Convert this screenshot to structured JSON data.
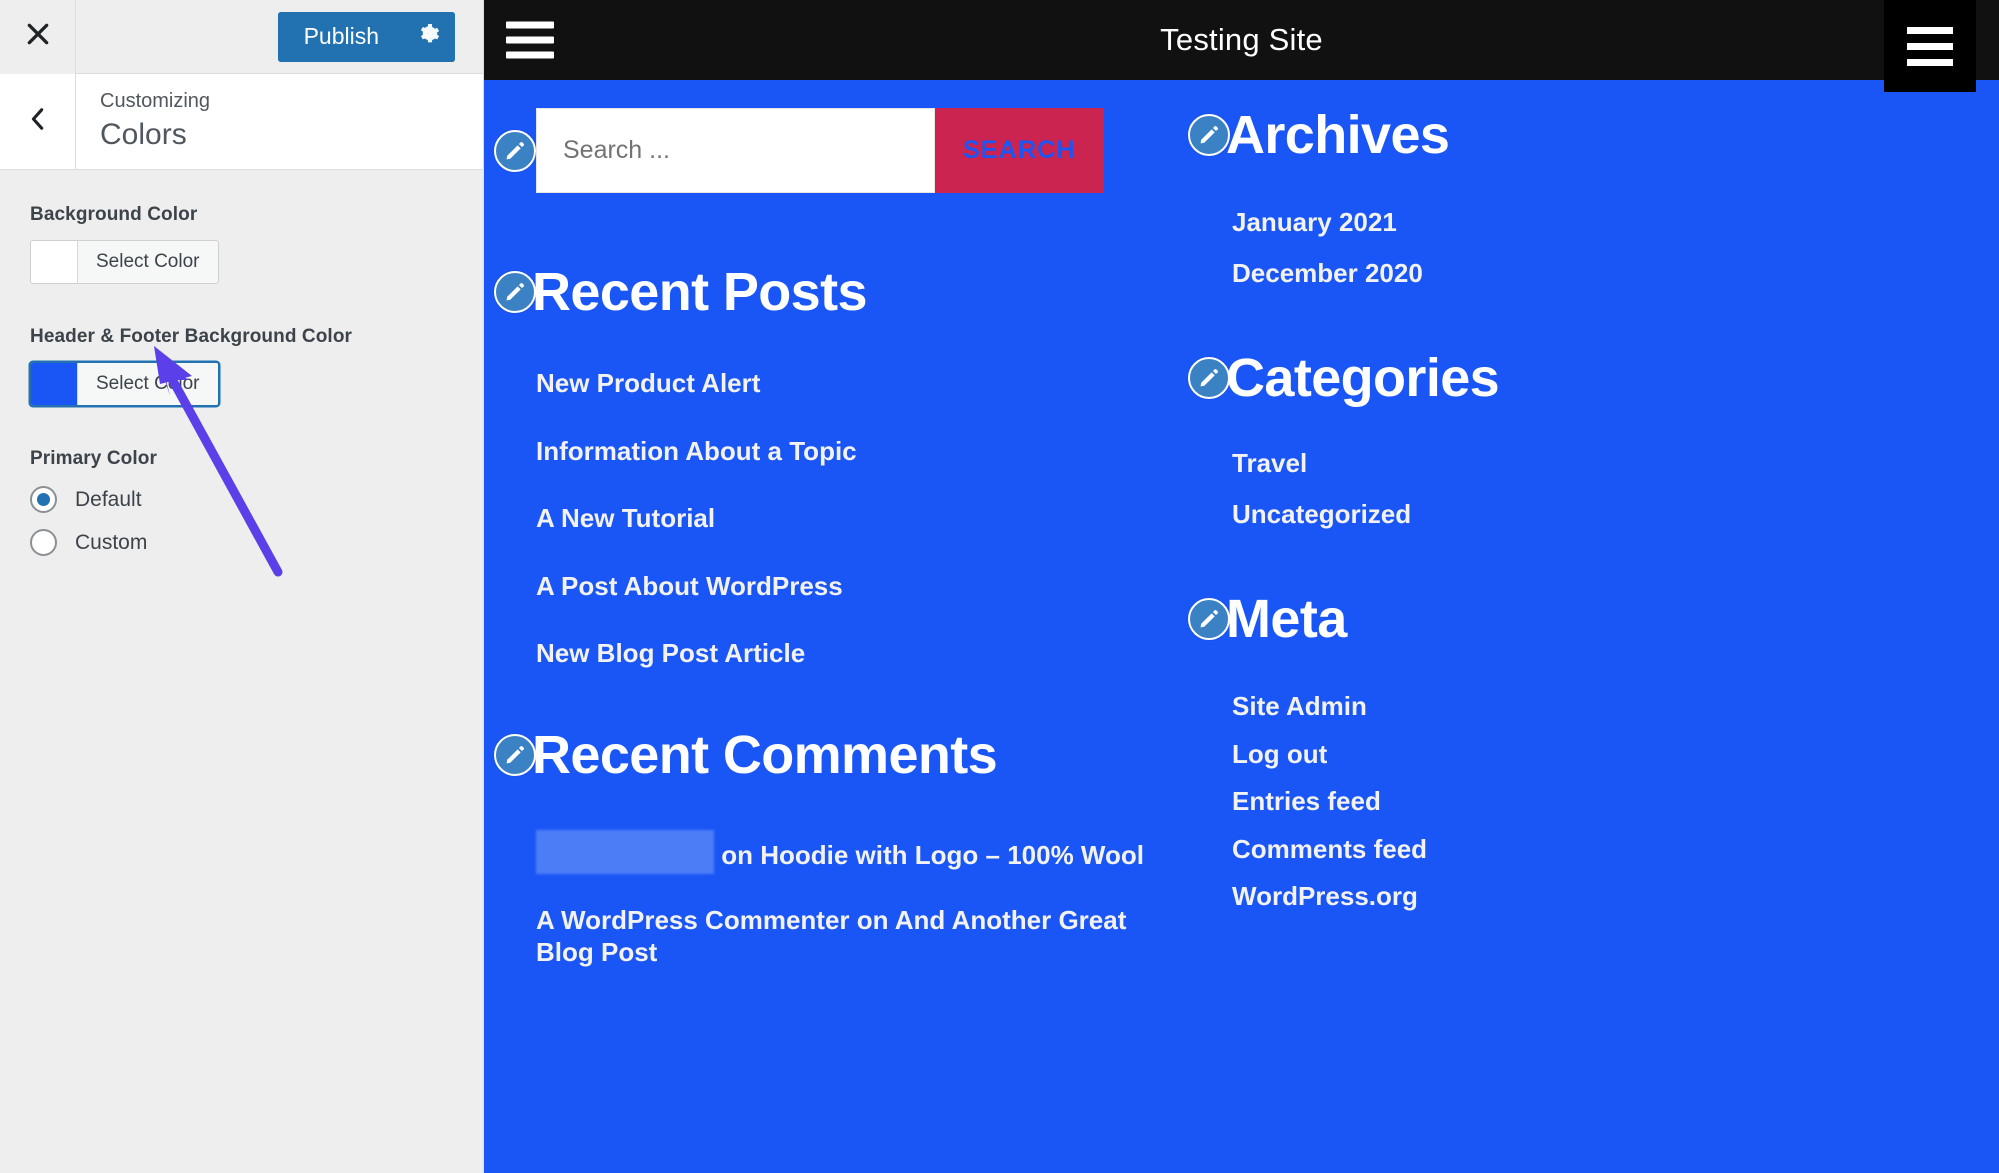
{
  "customizer": {
    "close_icon": "close-x-icon",
    "publish_label": "Publish",
    "gear_icon": "gear-icon",
    "back_icon": "chevron-left-icon",
    "eyebrow": "Customizing",
    "title": "Colors",
    "controls": [
      {
        "label": "Background Color",
        "button_label": "Select Color",
        "swatch_color": "#ffffff",
        "focused": false
      },
      {
        "label": "Header & Footer Background Color",
        "button_label": "Select Color",
        "swatch_color": "#1a56f5",
        "focused": true
      }
    ],
    "primary_color": {
      "label": "Primary Color",
      "options": [
        {
          "label": "Default",
          "selected": true
        },
        {
          "label": "Custom",
          "selected": false
        }
      ]
    },
    "annotation": {
      "type": "arrow",
      "color": "#5b3fe8",
      "points_to": "Header & Footer Background Color swatch"
    }
  },
  "preview": {
    "topbar": {
      "menu_icon": "hamburger-menu-icon",
      "site_title": "Testing Site",
      "corner_menu_icon": "hamburger-menu-icon"
    },
    "theme": {
      "header_footer_background": "#1a56f5",
      "search_button_background": "#cc2450",
      "search_button_text_color": "#1a56f5",
      "topbar_background": "#111111"
    },
    "search": {
      "placeholder": "Search ...",
      "value": "",
      "button_label": "SEARCH",
      "edit_icon": "pencil-edit-icon"
    },
    "widgets": [
      {
        "id": "recent-posts",
        "title": "Recent Posts",
        "edit_icon": "pencil-edit-icon",
        "items": [
          "New Product Alert",
          "Information About a Topic",
          "A New Tutorial",
          "A Post About WordPress",
          "New Blog Post Article"
        ]
      },
      {
        "id": "recent-comments",
        "title": "Recent Comments",
        "edit_icon": "pencil-edit-icon",
        "items": [
          {
            "redacted_prefix": true,
            "text": "on Hoodie with Logo – 100% Wool"
          },
          {
            "redacted_prefix": false,
            "text": "A WordPress Commenter on And Another Great Blog Post"
          }
        ]
      },
      {
        "id": "archives",
        "title": "Archives",
        "edit_icon": "pencil-edit-icon",
        "items": [
          "January 2021",
          "December 2020"
        ]
      },
      {
        "id": "categories",
        "title": "Categories",
        "edit_icon": "pencil-edit-icon",
        "items": [
          "Travel",
          "Uncategorized"
        ]
      },
      {
        "id": "meta",
        "title": "Meta",
        "edit_icon": "pencil-edit-icon",
        "items": [
          "Site Admin",
          "Log out",
          "Entries feed",
          "Comments feed",
          "WordPress.org"
        ]
      }
    ]
  }
}
